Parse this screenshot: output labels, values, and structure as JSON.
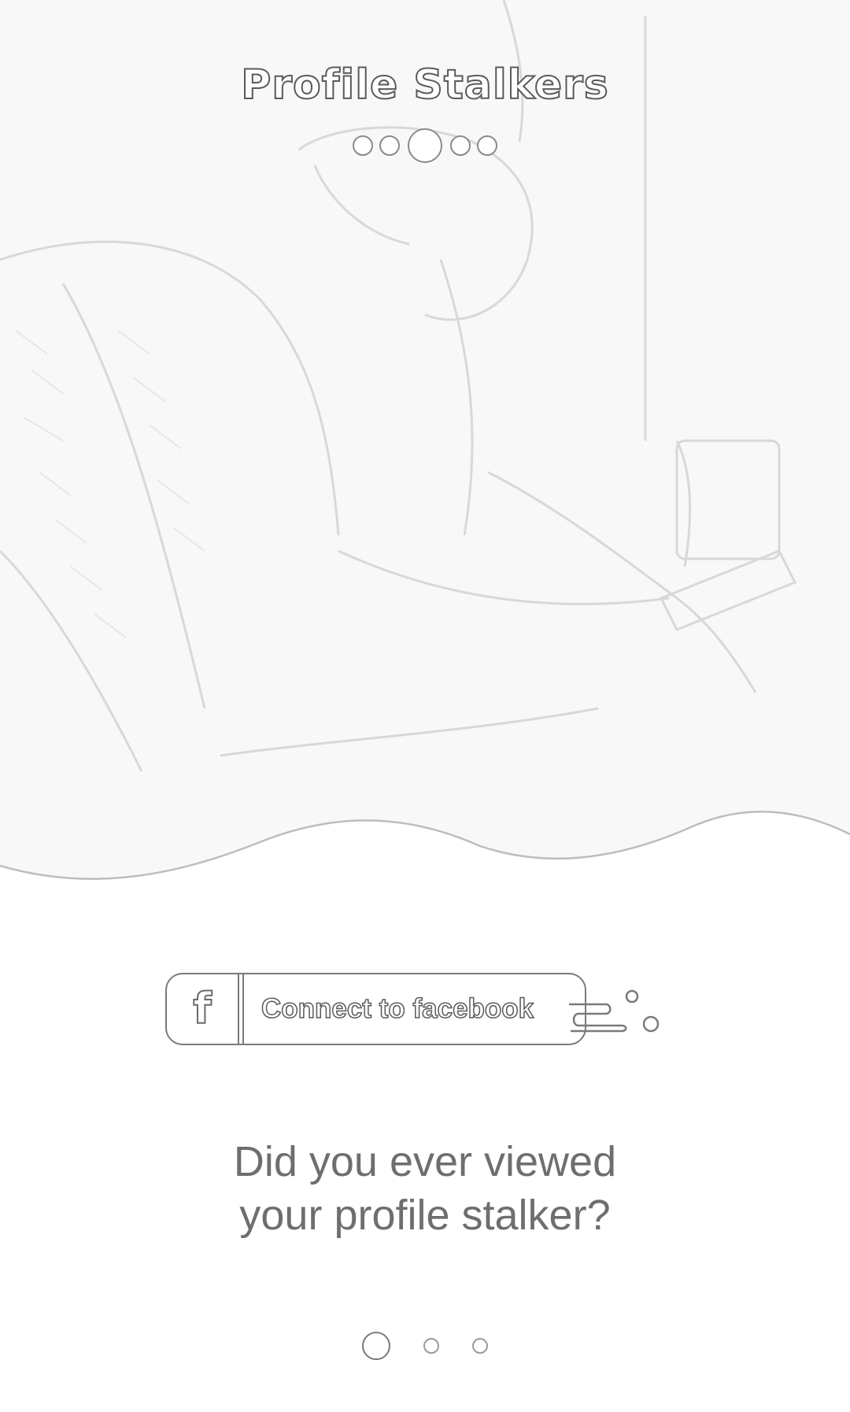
{
  "header": {
    "app_title": "Profile Stalkers",
    "page_indicator": {
      "count": 5,
      "active_index": 2
    }
  },
  "hero": {
    "image_description_icon": "person-with-phone-illustration"
  },
  "facebook_button": {
    "icon": "facebook-f-icon",
    "label": "Connect to facebook"
  },
  "question": {
    "line1": "Did you ever viewed",
    "line2": "your profile stalker?"
  },
  "pager": {
    "count": 3,
    "active_index": 0
  },
  "colors": {
    "background": "#ffffff",
    "outline": "#7a7a7a",
    "text": "#6e6e6e"
  }
}
